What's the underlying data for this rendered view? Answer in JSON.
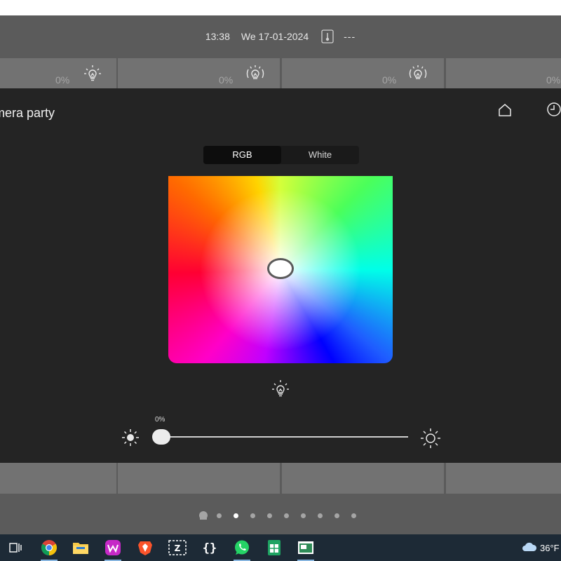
{
  "status_bar": {
    "time": "13:38",
    "date": "We 17-01-2024",
    "temperature": "---"
  },
  "top_tiles": [
    {
      "value": "0%"
    },
    {
      "value": "0%"
    },
    {
      "value": "0%"
    },
    {
      "value": "0%"
    }
  ],
  "dialog": {
    "title": "mera party",
    "mode_tabs": [
      {
        "label": "RGB",
        "active": true
      },
      {
        "label": "White",
        "active": false
      }
    ],
    "brightness": {
      "value_label": "0%",
      "value": 0
    }
  },
  "page_dots": {
    "count": 10,
    "active_index": 2
  },
  "taskbar": {
    "apps": [
      "task-view",
      "chrome",
      "file-explorer",
      "wps-office",
      "brave-browser",
      "zotero",
      "code-editor",
      "whatsapp",
      "sheets",
      "active-app"
    ],
    "weather": {
      "temperature": "36°F"
    }
  },
  "colors": {
    "accent": "#ffffff",
    "dialog_bg": "#242424",
    "panel_bg": "#5b5b5b",
    "taskbar_bg": "#1d2a36"
  }
}
